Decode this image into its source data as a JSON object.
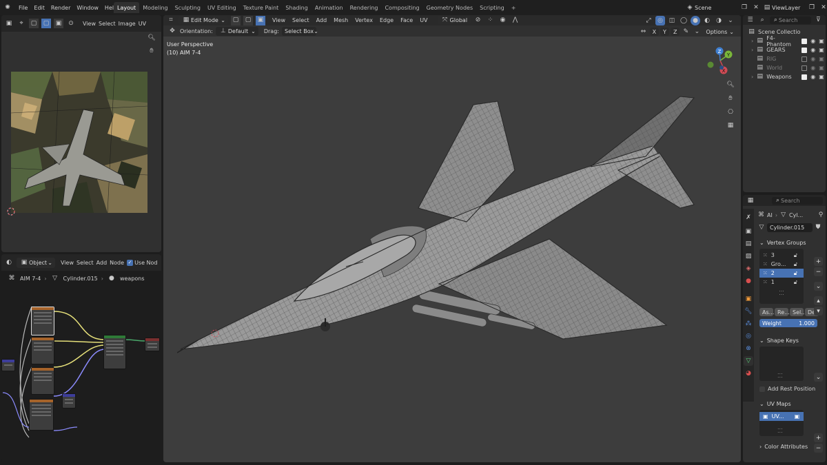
{
  "menu": [
    "File",
    "Edit",
    "Render",
    "Window",
    "Help"
  ],
  "workspaces": [
    "Layout",
    "Modeling",
    "Sculpting",
    "UV Editing",
    "Texture Paint",
    "Shading",
    "Animation",
    "Rendering",
    "Compositing",
    "Geometry Nodes",
    "Scripting"
  ],
  "active_workspace": "Layout",
  "scene": "Scene",
  "view_layer": "ViewLayer",
  "image_editor": {
    "menus": [
      "View",
      "Select",
      "Image",
      "UV"
    ]
  },
  "node_editor": {
    "mode": "Object",
    "menus": [
      "View",
      "Select",
      "Add",
      "Node"
    ],
    "use_nodes_label": "Use Nod",
    "breadcrumb": [
      "AIM 7-4",
      "Cylinder.015",
      "weapons"
    ]
  },
  "viewport": {
    "mode": "Edit Mode",
    "menus": [
      "View",
      "Select",
      "Add",
      "Mesh",
      "Vertex",
      "Edge",
      "Face",
      "UV"
    ],
    "transform": "Global",
    "orientation_label": "Orientation:",
    "orientation_value": "Default",
    "drag_label": "Drag:",
    "drag_value": "Select Box",
    "perspective": "User Perspective",
    "object_info": "(10) AIM 7-4",
    "axes": [
      "X",
      "Y",
      "Z"
    ],
    "options_label": "Options",
    "gizmo": {
      "x": "X",
      "y": "Y",
      "z": "Z"
    }
  },
  "outliner": {
    "search_placeholder": "Search",
    "root": "Scene Collectio",
    "items": [
      {
        "name": "F4-Phantom",
        "enabled": true
      },
      {
        "name": "GEARS",
        "enabled": true
      },
      {
        "name": "RIG",
        "enabled": false
      },
      {
        "name": "World",
        "enabled": false
      },
      {
        "name": "Weapons",
        "enabled": true
      }
    ]
  },
  "properties": {
    "search_placeholder": "Search",
    "breadcrumb": [
      "AI",
      "Cyl..."
    ],
    "mesh_name": "Cylinder.015",
    "vertex_groups_title": "Vertex Groups",
    "vertex_groups": [
      "3",
      "Gro...",
      "2",
      "1"
    ],
    "selected_group": "2",
    "vg_buttons": [
      "As...",
      "Re...",
      "Sel...",
      "De..."
    ],
    "weight_label": "Weight",
    "weight_value": "1.000",
    "shape_keys_title": "Shape Keys",
    "add_rest_position": "Add Rest Position",
    "uv_maps_title": "UV Maps",
    "uv_map": "UV...",
    "color_attributes_title": "Color Attributes"
  },
  "colors": {
    "accent": "#4772b3",
    "x_axis": "#d14b55",
    "y_axis": "#7ab73a",
    "z_axis": "#3f7fd1"
  }
}
